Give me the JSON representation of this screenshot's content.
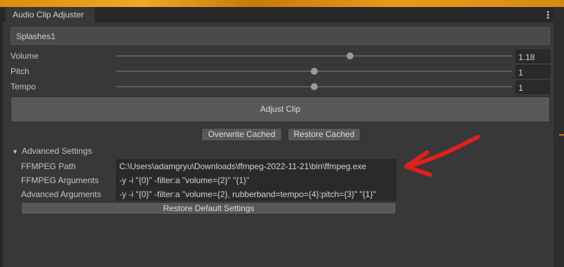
{
  "window": {
    "title": "Audio Clip Adjuster",
    "menu_icon": "kebab-menu-icon"
  },
  "clip_name": "Splashes1",
  "controls": {
    "volume": {
      "label": "Volume",
      "value": "1.18",
      "slider_fraction": 0.59
    },
    "pitch": {
      "label": "Pitch",
      "value": "1",
      "slider_fraction": 0.5
    },
    "tempo": {
      "label": "Tempo",
      "value": "1",
      "slider_fraction": 0.5
    }
  },
  "buttons": {
    "adjust": "Adjust Clip",
    "overwrite_cached": "Overwrite Cached",
    "restore_cached": "Restore Cached",
    "restore_defaults": "Restore Default Settings"
  },
  "advanced": {
    "title": "Advanced Settings",
    "ffmpeg_path": {
      "label": "FFMPEG Path",
      "value": "C:\\Users\\adamgryu\\Downloads\\ffmpeg-2022-11-21\\bin\\ffmpeg.exe"
    },
    "ffmpeg_arguments": {
      "label": "FFMPEG Arguments",
      "value": "-y -i \"{0}\" -filter:a \"volume={2}\" \"{1}\""
    },
    "advanced_arguments": {
      "label": "Advanced Arguments",
      "value": "-y -i \"{0}\" -filter:a \"volume={2}, rubberband=tempo={4}:pitch={3}\" \"{1}\""
    }
  },
  "colors": {
    "annotation_arrow": "#e0201c",
    "accent_bg": "#e89a1c"
  }
}
